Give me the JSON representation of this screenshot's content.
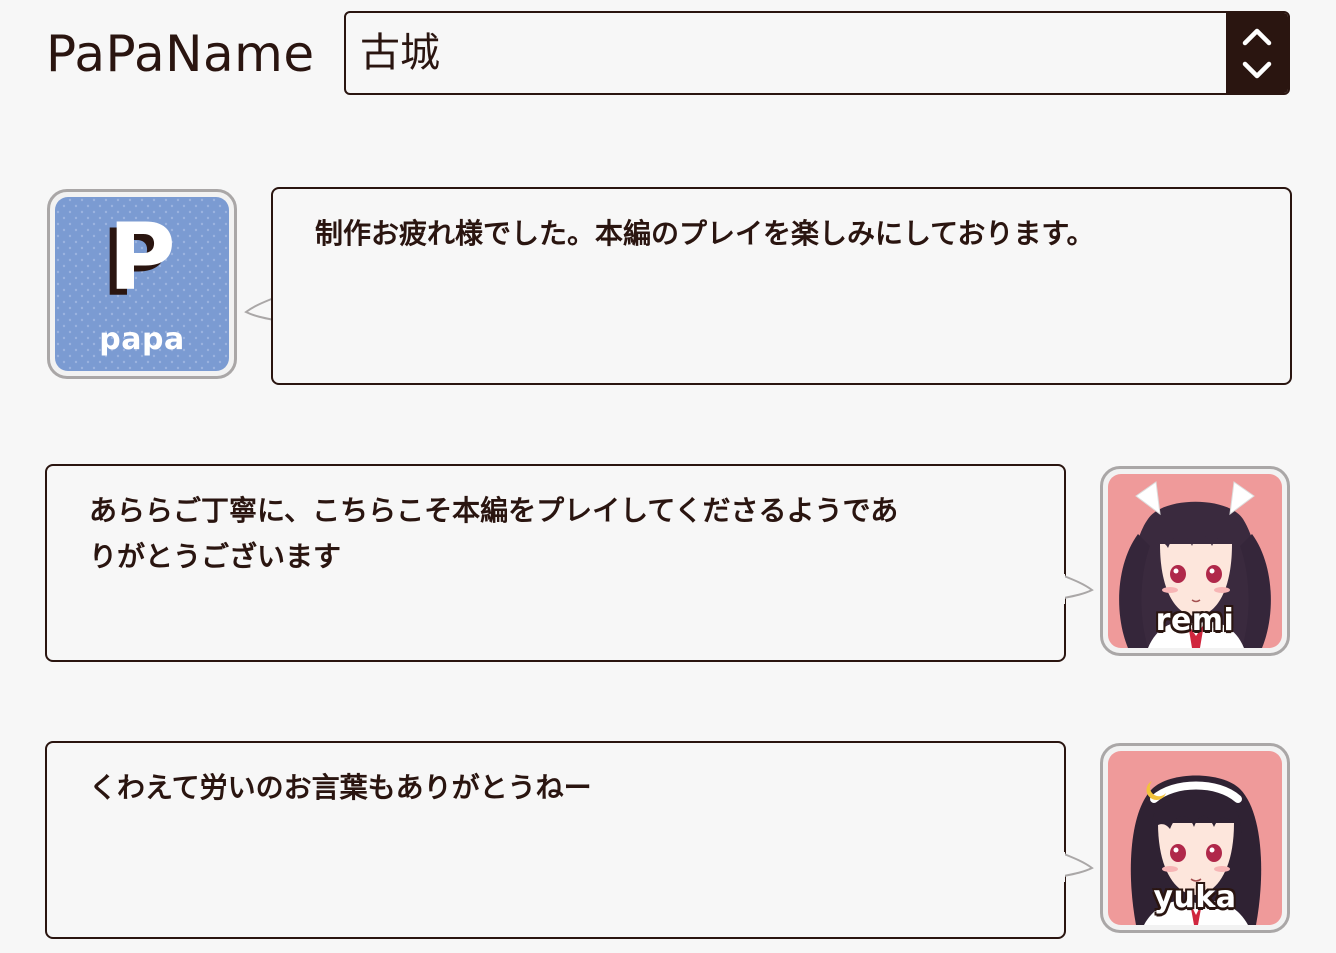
{
  "header": {
    "label": "PaPaName",
    "selected_name": "古城"
  },
  "messages": [
    {
      "speaker": "papa",
      "avatar_label": "papa",
      "avatar_letter": "P",
      "text": "制作お疲れ様でした。本編のプレイを楽しみにしております。"
    },
    {
      "speaker": "remi",
      "avatar_label": "remi",
      "text": "あららご丁寧に、こちらこそ本編をプレイしてくださるようであ\nりがとうございます"
    },
    {
      "speaker": "yuka",
      "avatar_label": "yuka",
      "text": "くわえて労いのお言葉もありがとうねー"
    }
  ],
  "colors": {
    "background": "#f7f7f7",
    "text": "#2a1510",
    "border": "#2a1510",
    "papa_avatar_bg": "#7b9bd2",
    "character_avatar_bg": "#ef9a9a"
  },
  "icons": {
    "spinner": "chevron-up-down-icon"
  }
}
